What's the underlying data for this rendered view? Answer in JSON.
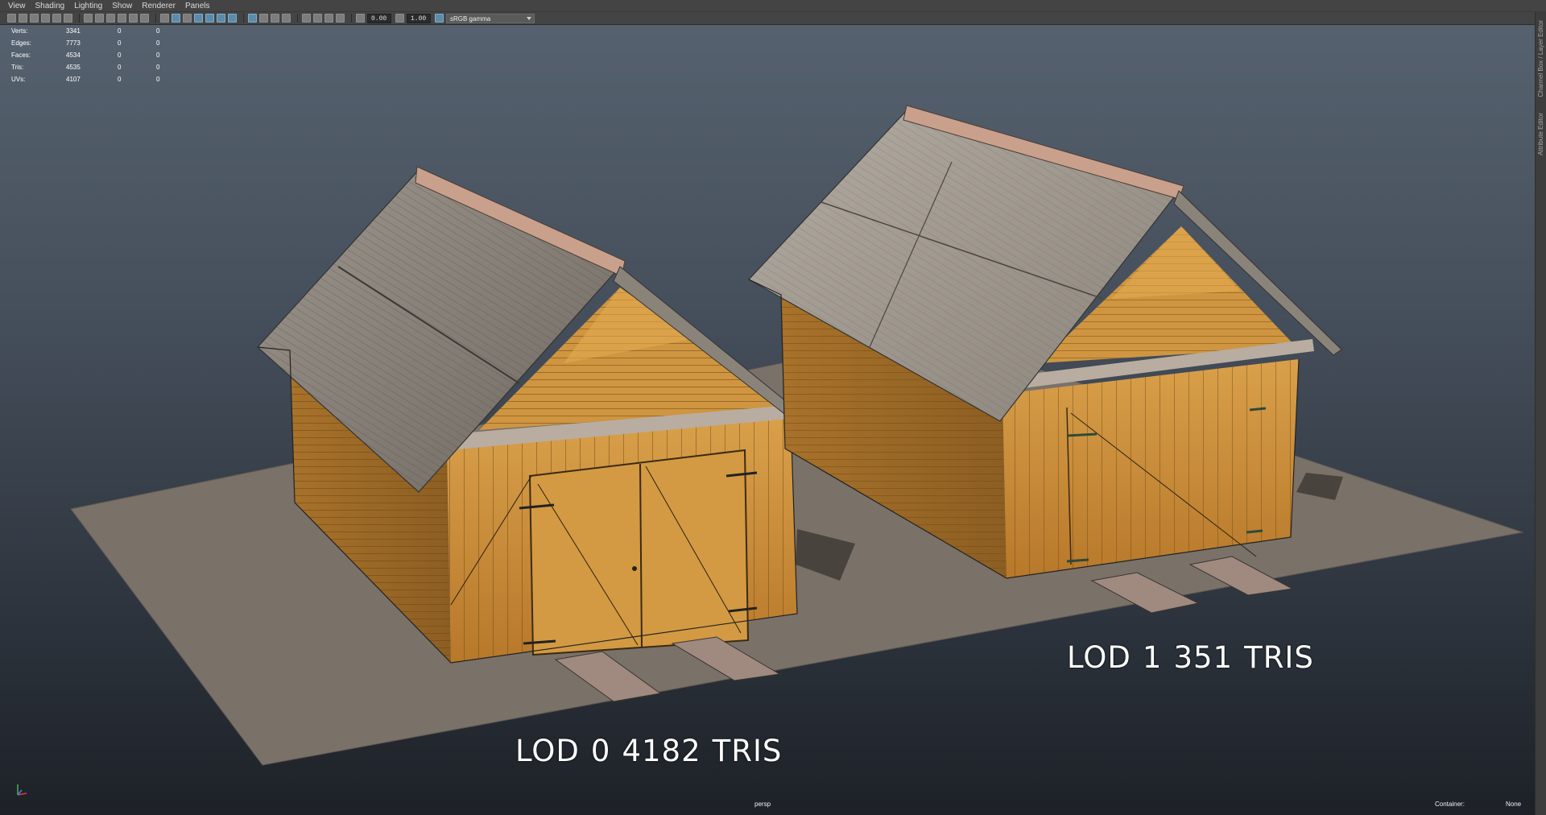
{
  "menu": [
    "View",
    "Shading",
    "Lighting",
    "Show",
    "Renderer",
    "Panels"
  ],
  "toolbar": {
    "exposure": "0.00",
    "gamma": "1.00",
    "color_space": "sRGB gamma"
  },
  "stats": {
    "rows": [
      {
        "label": "Verts:",
        "values": [
          "3341",
          "0",
          "0"
        ]
      },
      {
        "label": "Edges:",
        "values": [
          "7773",
          "0",
          "0"
        ]
      },
      {
        "label": "Faces:",
        "values": [
          "4534",
          "0",
          "0"
        ]
      },
      {
        "label": "Tris:",
        "values": [
          "4535",
          "0",
          "0"
        ]
      },
      {
        "label": "UVs:",
        "values": [
          "4107",
          "0",
          "0"
        ]
      }
    ]
  },
  "labels": {
    "lod0": [
      "LOD",
      "0",
      "4182",
      "TRIS"
    ],
    "lod1": [
      "LOD",
      "1",
      "351",
      "TRIS"
    ]
  },
  "viewport": {
    "camera": "persp",
    "container_label": "Container:",
    "container_value": "None"
  },
  "side_panel": {
    "channel_box": "Channel Box / Layer Editor",
    "attribute_editor": "Attribute Editor"
  },
  "colors": {
    "wood": "#c98d34",
    "wood_dark": "#8a5a1c",
    "roof": "#8f8880",
    "ground": "#7a7169"
  }
}
